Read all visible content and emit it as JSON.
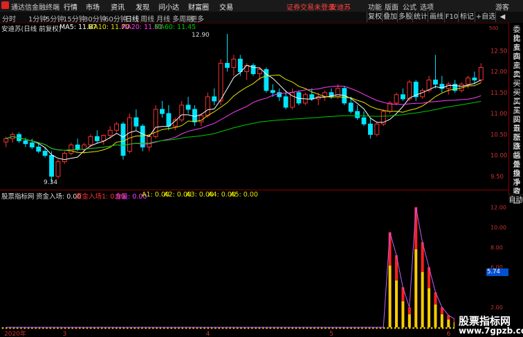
{
  "app": {
    "title": "通达信金融终端",
    "menus": [
      "行情",
      "市场",
      "资讯",
      "发现",
      "问小达",
      "财富圈",
      "交易"
    ],
    "notice": "证券交易未登录",
    "stock": "安迪苏",
    "right_menus": [
      "功能",
      "版面",
      "公式",
      "选项",
      "游客"
    ]
  },
  "toolbar": {
    "periods": [
      "1分钟",
      "5分钟",
      "15分钟",
      "30分钟",
      "60分钟",
      "日线",
      "周线",
      "月线",
      "多周期",
      "更多"
    ],
    "active_period": "日线",
    "lead": "分时",
    "buttons": [
      "复权",
      "叠加",
      "多股",
      "统计",
      "画线",
      "F10",
      "标记",
      "+自选",
      "◀"
    ]
  },
  "chart_info": {
    "name": "安迪苏(日线 前复权)",
    "ma5": "MA5: 11.87",
    "ma10": "MA10: 11.70",
    "ma20": "MA20: 11.61",
    "ma60": "MA60: 11.45"
  },
  "indicator_info": {
    "name": "股票指标网",
    "title": "资金入场: 0.00",
    "red": "资金入场1: 0.00",
    "vol": "含量: 0.00",
    "a1": "A1: 0.00",
    "a2": "A2: 0.00",
    "a3": "A3: 0.00",
    "a4": "A4: 0.00",
    "a5": "A5: 0.00"
  },
  "price_axis": [
    "12.50",
    "12.00",
    "11.50",
    "11.00",
    "10.50",
    "10.00",
    "9.50"
  ],
  "ind_axis": [
    "12.00",
    "10.00",
    "8.00",
    "6.00",
    "2.00"
  ],
  "ind_current": "5.74",
  "annotations": {
    "high": "12.90",
    "low": "9.34",
    "top_tag": "500"
  },
  "date_axis": [
    "2020年",
    "3",
    "4",
    "5",
    "6"
  ],
  "sidebar": [
    "委比",
    "卖五",
    "卖四",
    "卖三",
    "卖二",
    "卖一",
    "买一",
    "买二",
    "买三",
    "买四",
    "买五",
    "最新",
    "涨跌",
    "涨幅",
    "总量",
    "外盘",
    "换手",
    "净资",
    "收益"
  ],
  "auto_label": "自动",
  "watermark": {
    "line1": "股票指标网",
    "line2": "www.7gpzb.com"
  },
  "colors": {
    "up": "#ff3232",
    "down": "#00e5ff",
    "ma5": "#ffffff",
    "ma10": "#e6e600",
    "ma20": "#ff40ff",
    "ma60": "#00cc00"
  },
  "chart_data": {
    "type": "candlestick",
    "price_range": [
      9.2,
      13.0
    ],
    "candles": [
      [
        10.32,
        10.45,
        10.2,
        10.4
      ],
      [
        10.4,
        10.55,
        10.3,
        10.5
      ],
      [
        10.5,
        10.55,
        10.3,
        10.35
      ],
      [
        10.35,
        10.42,
        10.2,
        10.28
      ],
      [
        10.3,
        10.4,
        10.15,
        10.2
      ],
      [
        10.2,
        10.28,
        10.05,
        10.1
      ],
      [
        10.1,
        10.2,
        9.95,
        10.0
      ],
      [
        10.0,
        10.1,
        9.34,
        9.5
      ],
      [
        9.5,
        9.9,
        9.45,
        9.85
      ],
      [
        9.85,
        10.1,
        9.8,
        10.05
      ],
      [
        10.05,
        10.3,
        10.0,
        10.25
      ],
      [
        10.25,
        10.4,
        10.1,
        10.15
      ],
      [
        10.15,
        10.3,
        10.05,
        10.25
      ],
      [
        10.25,
        10.5,
        10.2,
        10.45
      ],
      [
        10.45,
        10.6,
        10.3,
        10.35
      ],
      [
        10.35,
        10.5,
        10.25,
        10.48
      ],
      [
        10.48,
        10.7,
        10.4,
        10.6
      ],
      [
        10.6,
        10.8,
        10.55,
        10.75
      ],
      [
        10.75,
        10.8,
        9.9,
        10.0
      ],
      [
        10.1,
        11.0,
        10.05,
        10.9
      ],
      [
        10.9,
        11.1,
        10.6,
        10.7
      ],
      [
        10.7,
        10.75,
        10.1,
        10.2
      ],
      [
        10.2,
        10.5,
        10.1,
        10.45
      ],
      [
        10.45,
        11.2,
        10.4,
        11.1
      ],
      [
        11.1,
        11.3,
        10.9,
        11.0
      ],
      [
        11.0,
        11.2,
        10.6,
        10.7
      ],
      [
        10.7,
        10.9,
        10.6,
        10.85
      ],
      [
        10.85,
        11.3,
        10.8,
        11.2
      ],
      [
        11.2,
        11.4,
        11.0,
        11.1
      ],
      [
        11.1,
        11.2,
        10.7,
        10.8
      ],
      [
        10.8,
        11.0,
        10.7,
        10.95
      ],
      [
        10.95,
        11.5,
        10.9,
        11.4
      ],
      [
        11.4,
        11.6,
        11.2,
        11.3
      ],
      [
        11.3,
        12.3,
        11.2,
        12.2
      ],
      [
        12.2,
        12.9,
        12.0,
        12.1
      ],
      [
        12.1,
        12.4,
        11.9,
        12.3
      ],
      [
        12.3,
        12.4,
        11.9,
        12.0
      ],
      [
        12.0,
        12.2,
        11.8,
        12.15
      ],
      [
        12.15,
        12.2,
        11.9,
        11.95
      ],
      [
        11.95,
        12.1,
        11.8,
        12.05
      ],
      [
        12.05,
        12.1,
        11.5,
        11.55
      ],
      [
        11.55,
        11.7,
        11.4,
        11.5
      ],
      [
        11.5,
        11.6,
        11.3,
        11.4
      ],
      [
        11.4,
        11.55,
        11.1,
        11.15
      ],
      [
        11.15,
        11.6,
        11.1,
        11.5
      ],
      [
        11.5,
        11.55,
        11.2,
        11.25
      ],
      [
        11.25,
        11.5,
        11.2,
        11.45
      ],
      [
        11.45,
        11.6,
        11.3,
        11.35
      ],
      [
        11.35,
        11.5,
        11.2,
        11.4
      ],
      [
        11.4,
        11.55,
        11.3,
        11.5
      ],
      [
        11.5,
        11.6,
        11.35,
        11.4
      ],
      [
        11.4,
        11.7,
        11.35,
        11.6
      ],
      [
        11.6,
        11.65,
        11.2,
        11.25
      ],
      [
        11.25,
        11.4,
        11.0,
        11.05
      ],
      [
        11.05,
        11.2,
        10.85,
        10.9
      ],
      [
        10.9,
        11.05,
        10.7,
        10.75
      ],
      [
        10.75,
        10.9,
        10.4,
        10.5
      ],
      [
        10.5,
        10.8,
        10.45,
        10.75
      ],
      [
        10.75,
        11.1,
        10.7,
        11.05
      ],
      [
        11.05,
        11.3,
        11.0,
        11.25
      ],
      [
        11.25,
        11.5,
        11.2,
        11.45
      ],
      [
        11.45,
        11.6,
        11.3,
        11.35
      ],
      [
        11.35,
        11.8,
        11.3,
        11.75
      ],
      [
        11.75,
        11.8,
        11.3,
        11.4
      ],
      [
        11.4,
        11.6,
        11.35,
        11.55
      ],
      [
        11.55,
        11.9,
        11.5,
        11.8
      ],
      [
        11.8,
        12.4,
        11.6,
        11.7
      ],
      [
        11.7,
        11.9,
        11.5,
        11.6
      ],
      [
        11.6,
        11.75,
        11.45,
        11.7
      ],
      [
        11.7,
        11.8,
        11.5,
        11.55
      ],
      [
        11.55,
        11.75,
        11.5,
        11.7
      ],
      [
        11.7,
        11.9,
        11.6,
        11.85
      ],
      [
        11.85,
        12.0,
        11.7,
        11.8
      ],
      [
        11.8,
        12.2,
        11.75,
        12.1
      ]
    ],
    "indicator_bars": [
      0,
      0,
      0,
      0,
      0,
      0,
      0,
      0,
      0,
      0,
      0,
      0,
      0,
      0,
      0,
      0,
      0,
      0,
      0,
      0,
      0,
      0,
      0,
      0,
      0,
      0,
      0,
      0,
      0,
      0,
      0,
      0,
      0,
      0,
      0,
      0,
      0,
      0,
      0,
      0,
      0,
      0,
      0,
      0,
      0,
      0,
      0,
      0,
      0,
      0,
      0,
      0,
      0,
      0,
      0,
      0,
      0,
      0,
      0,
      9.5,
      7.2,
      4.0,
      2.0,
      12.0,
      8.5,
      6.0,
      3.5,
      2.0,
      1.2,
      0.8,
      0.5,
      0.3,
      0.2,
      0.1
    ],
    "indicator_range": [
      0,
      13
    ]
  }
}
